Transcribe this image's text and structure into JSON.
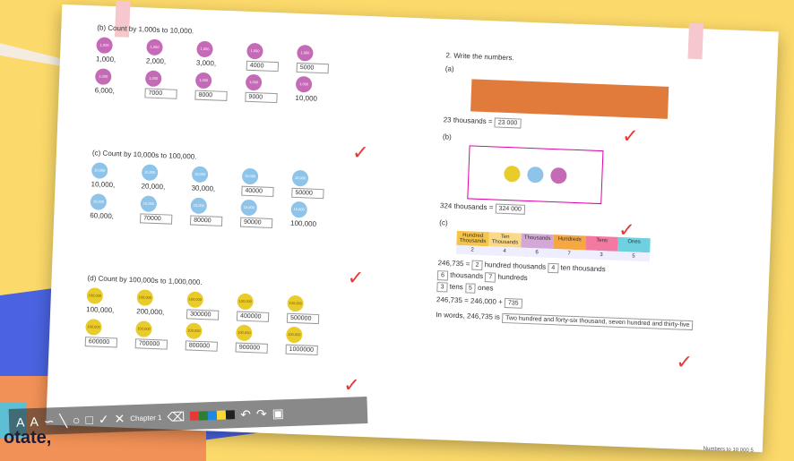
{
  "footer_text": "otate,",
  "book": {
    "left": {
      "b": {
        "title": "(b)  Count by 1,000s to 10,000.",
        "coin": "1,000",
        "values": [
          "1,000,",
          "2,000,",
          "3,000,",
          "4000",
          "5000",
          "6,000,",
          "7000",
          "8000",
          "9000",
          "10,000"
        ]
      },
      "c": {
        "title": "(c)  Count by 10,000s to 100,000.",
        "coin": "10,000",
        "values": [
          "10,000,",
          "20,000,",
          "30,000,",
          "40000",
          "50000",
          "60,000,",
          "70000",
          "80000",
          "90000",
          "100,000"
        ]
      },
      "d": {
        "title": "(d)  Count by 100,000s to 1,000,000.",
        "coin": "100,000",
        "values": [
          "100,000,",
          "200,000,",
          "300000",
          "400000",
          "500000",
          "600000",
          "700000",
          "800000",
          "900000",
          "1000000"
        ]
      }
    },
    "right": {
      "title": "2.   Write the numbers.",
      "a": {
        "label": "(a)",
        "text": "23 thousands =",
        "answer": "23 000"
      },
      "b": {
        "label": "(b)",
        "text": "324 thousands =",
        "answer": "324 000"
      },
      "c": {
        "label": "(c)",
        "headers": [
          "Hundred Thousands",
          "Ten Thousands",
          "Thousands",
          "Hundreds",
          "Tens",
          "Ones"
        ],
        "digits": [
          "2",
          "4",
          "6",
          "7",
          "3",
          "5"
        ],
        "line1": "246,735 =",
        "hundred_thousands_ans": "2",
        "hundred_thousands": "hundred thousands",
        "ten_thousands_ans": "4",
        "ten_thousands": "ten thousands",
        "thousands_ans": "6",
        "thousands": "thousands",
        "hundreds_ans": "7",
        "hundreds": "hundreds",
        "tens_ans": "3",
        "tens": "tens",
        "ones_ans": "5",
        "ones": "ones",
        "line2": "246,735 = 246,000 +",
        "line2_ans": "735",
        "words_label": "In words, 246,735 is",
        "words_ans": "Two hundred and forty-six thousand, seven hundred and thirty-five"
      },
      "page_number": "Numbers to 10 000   5"
    },
    "chapter_label": "Chapter 1"
  },
  "toolbar": {
    "colors": [
      "#e53935",
      "#2e7d32",
      "#1e88e5",
      "#fdd835",
      "#212121"
    ]
  }
}
